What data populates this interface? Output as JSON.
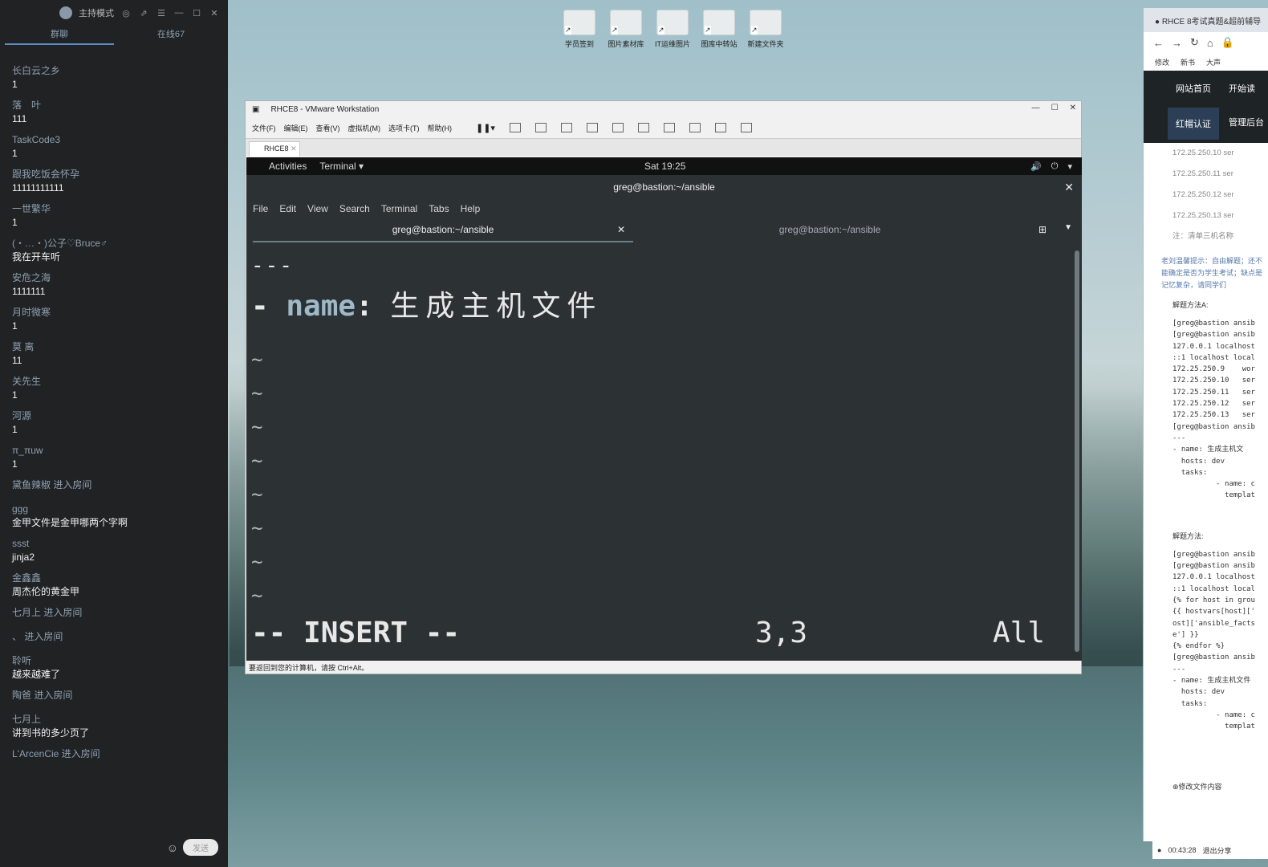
{
  "chat": {
    "top_mode": "主持模式",
    "tab_group": "群聊",
    "tab_online": "在线67",
    "messages": [
      {
        "name": "长白云之乡",
        "text": "1"
      },
      {
        "name": "落　叶",
        "text": "111"
      },
      {
        "name": "TaskCode3",
        "text": "1"
      },
      {
        "name": "跟我吃饭会怀孕",
        "text": "11111111111"
      },
      {
        "name": "一世繁华",
        "text": "1"
      },
      {
        "name": "(・…・)公子♡Bruce♂",
        "text": "我在开车听"
      },
      {
        "name": "安危之海",
        "text": "1111111"
      },
      {
        "name": "月时微寒",
        "text": "1"
      },
      {
        "name": "莫 离",
        "text": "11"
      },
      {
        "name": "关先生",
        "text": "1"
      },
      {
        "name": "河源",
        "text": "1"
      },
      {
        "name": "π_πuw",
        "text": "1"
      }
    ],
    "enter1": "黛鱼辣椒 进入房间",
    "messages2": [
      {
        "name": "ggg",
        "text": "金甲文件是金甲哪两个字啊"
      },
      {
        "name": "ssst",
        "text": "jinja2"
      },
      {
        "name": "金鑫鑫",
        "text": "周杰伦的黄金甲"
      }
    ],
    "enter2": "七月上 进入房间",
    "enter3": "、 进入房间",
    "messages3": [
      {
        "name": "聆听",
        "text": "越来越难了"
      }
    ],
    "enter4": "陶爸 进入房间",
    "messages4": [
      {
        "name": "七月上",
        "text": "讲到书的多少页了"
      }
    ],
    "enter5": "L'ArcenCie 进入房间",
    "send_label": "发送"
  },
  "desktop_icons": [
    "学员签到",
    "图片素材库",
    "IT运维图片",
    "图库中转站",
    "新建文件夹"
  ],
  "vmware": {
    "title": "RHCE8 - VMware Workstation",
    "menu": [
      "文件(F)",
      "编辑(E)",
      "查看(V)",
      "虚拟机(M)",
      "选项卡(T)",
      "帮助(H)"
    ],
    "tab": "RHCE8",
    "status": "要返回到您的计算机，请按 Ctrl+Alt。"
  },
  "gnome": {
    "activities": "Activities",
    "app": "Terminal ▾",
    "clock": "Sat 19:25"
  },
  "terminal": {
    "title": "greg@bastion:~/ansible",
    "menu": [
      "File",
      "Edit",
      "View",
      "Search",
      "Terminal",
      "Tabs",
      "Help"
    ],
    "tab1": "greg@bastion:~/ansible",
    "tab2": "greg@bastion:~/ansible"
  },
  "vim": {
    "line1": "---",
    "dash": "- ",
    "key": "name",
    "colon": ": ",
    "value": "生成主机文件",
    "tilde": "~",
    "mode": "-- INSERT --",
    "position": "3,3",
    "scroll": "All"
  },
  "browser": {
    "tab_title": "RHCE 8考试真题&超前辅导",
    "bookmarks": [
      "修改",
      "新书",
      "大声"
    ],
    "nav_home": "网站首页",
    "nav_start": "开始读",
    "nav_cert": "红帽认证",
    "nav_admin": "管理后台",
    "ips": [
      "172.25.250.10 ser",
      "172.25.250.11 ser",
      "172.25.250.12 ser",
      "172.25.250.13 ser"
    ],
    "note": "注：清单三机名称",
    "hint": "老刘温馨提示：自由解题；还不能确定是否为学生考试；缺点是记忆复杂，请同学们",
    "method_a": "解题方法A:",
    "code_a": "[greg@bastion ansib\n[greg@bastion ansib\n127.0.0.1 localhost\n::1 localhost local\n172.25.250.9    wor\n172.25.250.10   ser\n172.25.250.11   ser\n172.25.250.12   ser\n172.25.250.13   ser\n[greg@bastion ansib\n---\n- name: 生成主机文\n  hosts: dev\n  tasks:\n          - name: c\n            templat",
    "method_b": "解题方法:",
    "code_b": "[greg@bastion ansib\n[greg@bastion ansib\n127.0.0.1 localhost\n::1 localhost local\n{% for host in grou\n{{ hostvars[host]['\nost]['ansible_facts\ne'] }}\n{% endfor %}\n[greg@bastion ansib\n---\n- name: 生成主机文件\n  hosts: dev\n  tasks:\n          - name: c\n            templat",
    "edit_title": "⊕修改文件内容",
    "time": "00:43:28",
    "exit_share": "退出分享"
  }
}
